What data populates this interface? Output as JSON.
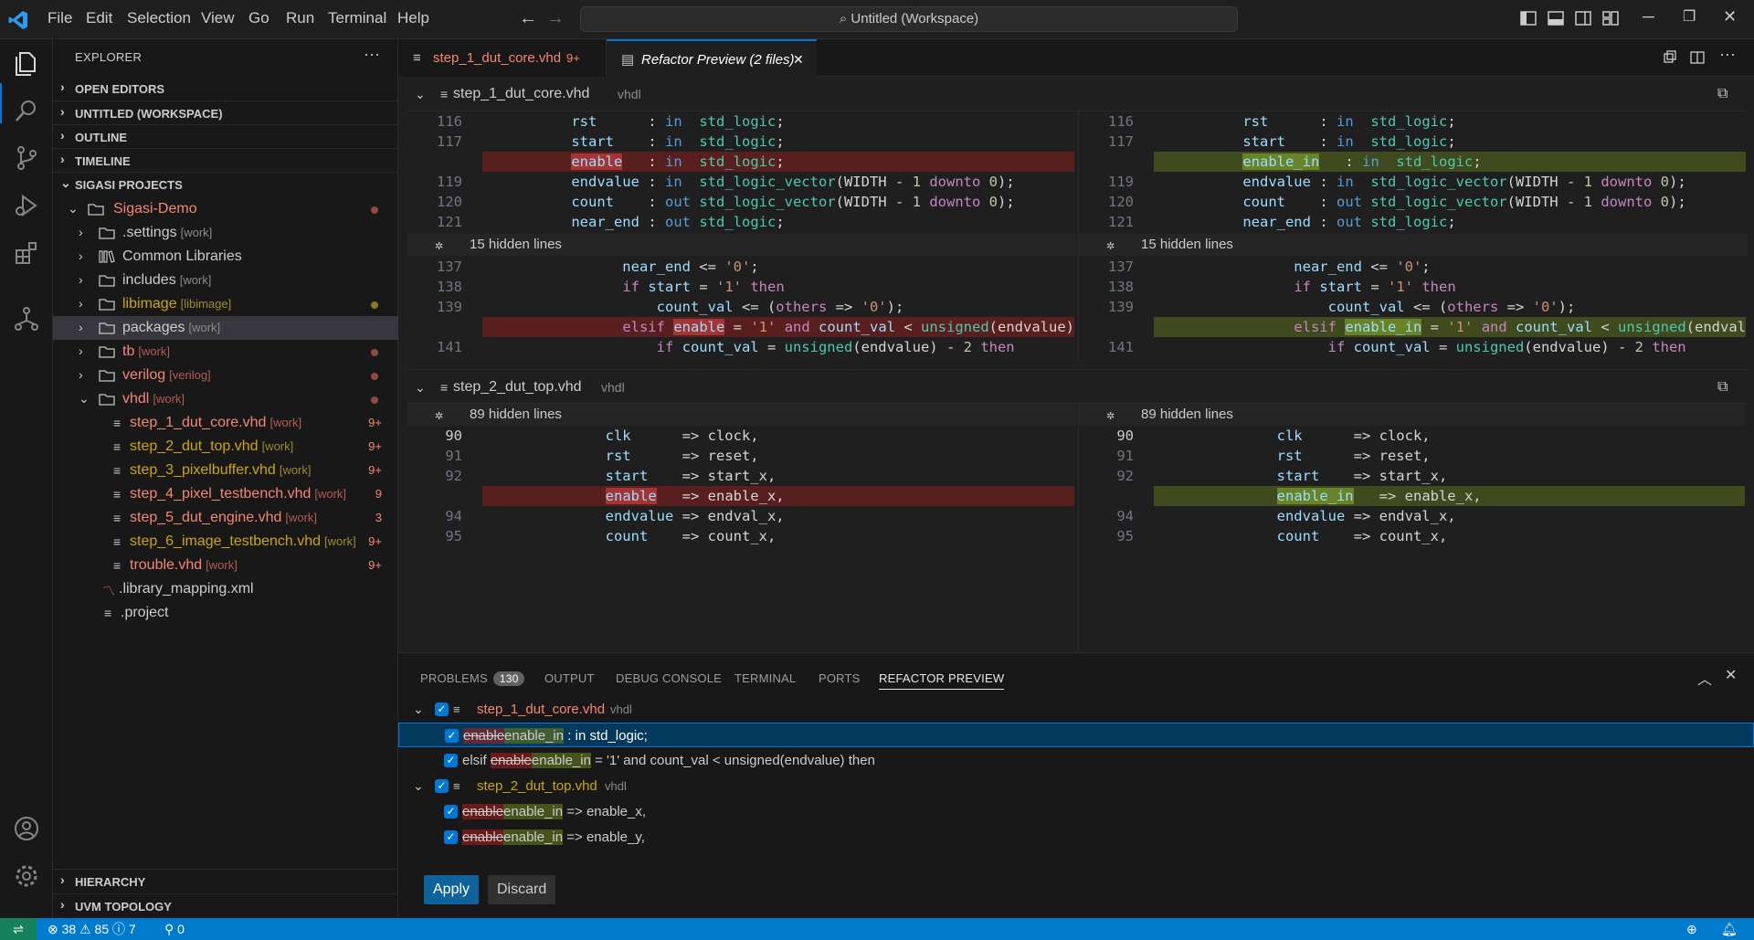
{
  "titlebar": {
    "menu": [
      "File",
      "Edit",
      "Selection",
      "View",
      "Go",
      "Run",
      "Terminal",
      "Help"
    ],
    "command_center": "Untitled (Workspace)"
  },
  "activity_bar": {
    "icons": [
      "explorer-icon",
      "search-icon",
      "source-control-icon",
      "run-debug-icon",
      "extensions-icon",
      "sigasi-icon",
      "account-icon",
      "manage-gear-icon"
    ]
  },
  "sidebar": {
    "title": "EXPLORER",
    "more": "···",
    "sections": {
      "open_editors": "OPEN EDITORS",
      "workspace": "UNTITLED (WORKSPACE)",
      "outline": "OUTLINE",
      "timeline": "TIMELINE",
      "sigasi": "SIGASI PROJECTS",
      "hierarchy": "HIERARCHY",
      "uvm": "UVM TOPOLOGY"
    },
    "tree": [
      {
        "label": "Sigasi-Demo",
        "tag": ""
      },
      {
        "label": ".settings",
        "tag": "[work]"
      },
      {
        "label": "Common Libraries",
        "tag": ""
      },
      {
        "label": "includes",
        "tag": "[work]"
      },
      {
        "label": "libimage",
        "tag": "[libimage]"
      },
      {
        "label": "packages",
        "tag": "[work]"
      },
      {
        "label": "tb",
        "tag": "[work]"
      },
      {
        "label": "verilog",
        "tag": "[verilog]"
      },
      {
        "label": "vhdl",
        "tag": "[work]"
      },
      {
        "label": "step_1_dut_core.vhd",
        "tag": "[work]",
        "badge": "9+"
      },
      {
        "label": "step_2_dut_top.vhd",
        "tag": "[work]",
        "badge": "9+"
      },
      {
        "label": "step_3_pixelbuffer.vhd",
        "tag": "[work]",
        "badge": "9+"
      },
      {
        "label": "step_4_pixel_testbench.vhd",
        "tag": "[work]",
        "badge": "9"
      },
      {
        "label": "step_5_dut_engine.vhd",
        "tag": "[work]",
        "badge": "3"
      },
      {
        "label": "step_6_image_testbench.vhd",
        "tag": "[work]",
        "badge": "9+"
      },
      {
        "label": "trouble.vhd",
        "tag": "[work]",
        "badge": "9+"
      },
      {
        "label": ".library_mapping.xml",
        "tag": ""
      },
      {
        "label": ".project",
        "tag": ""
      }
    ]
  },
  "tabs": [
    {
      "label": "step_1_dut_core.vhd",
      "badge": "9+"
    },
    {
      "label": "Refactor Preview (2 files)",
      "close": "✕"
    }
  ],
  "editor": {
    "file1": {
      "name": "step_1_dut_core.vhd",
      "lang": "vhdl"
    },
    "file2": {
      "name": "step_2_dut_top.vhd",
      "lang": "vhdl"
    },
    "hidden15": "15 hidden lines",
    "hidden89": "89 hidden lines"
  },
  "panel": {
    "tabs": [
      "PROBLEMS",
      "OUTPUT",
      "DEBUG CONSOLE",
      "TERMINAL",
      "PORTS",
      "REFACTOR PREVIEW"
    ],
    "problems_count": "130",
    "files": [
      {
        "name": "step_1_dut_core.vhd",
        "lang": "vhdl"
      },
      {
        "name": "step_2_dut_top.vhd",
        "lang": "vhdl"
      }
    ],
    "changes": [
      {
        "old": "enable",
        "new": "enable_in",
        "pre": "",
        "post": " : in std_logic;"
      },
      {
        "old": "enable",
        "new": "enable_in",
        "pre": "elsif ",
        "post": " = '1' and count_val < unsigned(endvalue) then"
      },
      {
        "old": "enable",
        "new": "enable_in",
        "pre": "",
        "post": " => enable_x,"
      },
      {
        "old": "enable",
        "new": "enable_in",
        "pre": "",
        "post": " => enable_y,"
      }
    ],
    "apply": "Apply",
    "discard": "Discard"
  },
  "statusbar": {
    "errors": "38",
    "warnings": "85",
    "infos": "7",
    "ports": "0"
  }
}
